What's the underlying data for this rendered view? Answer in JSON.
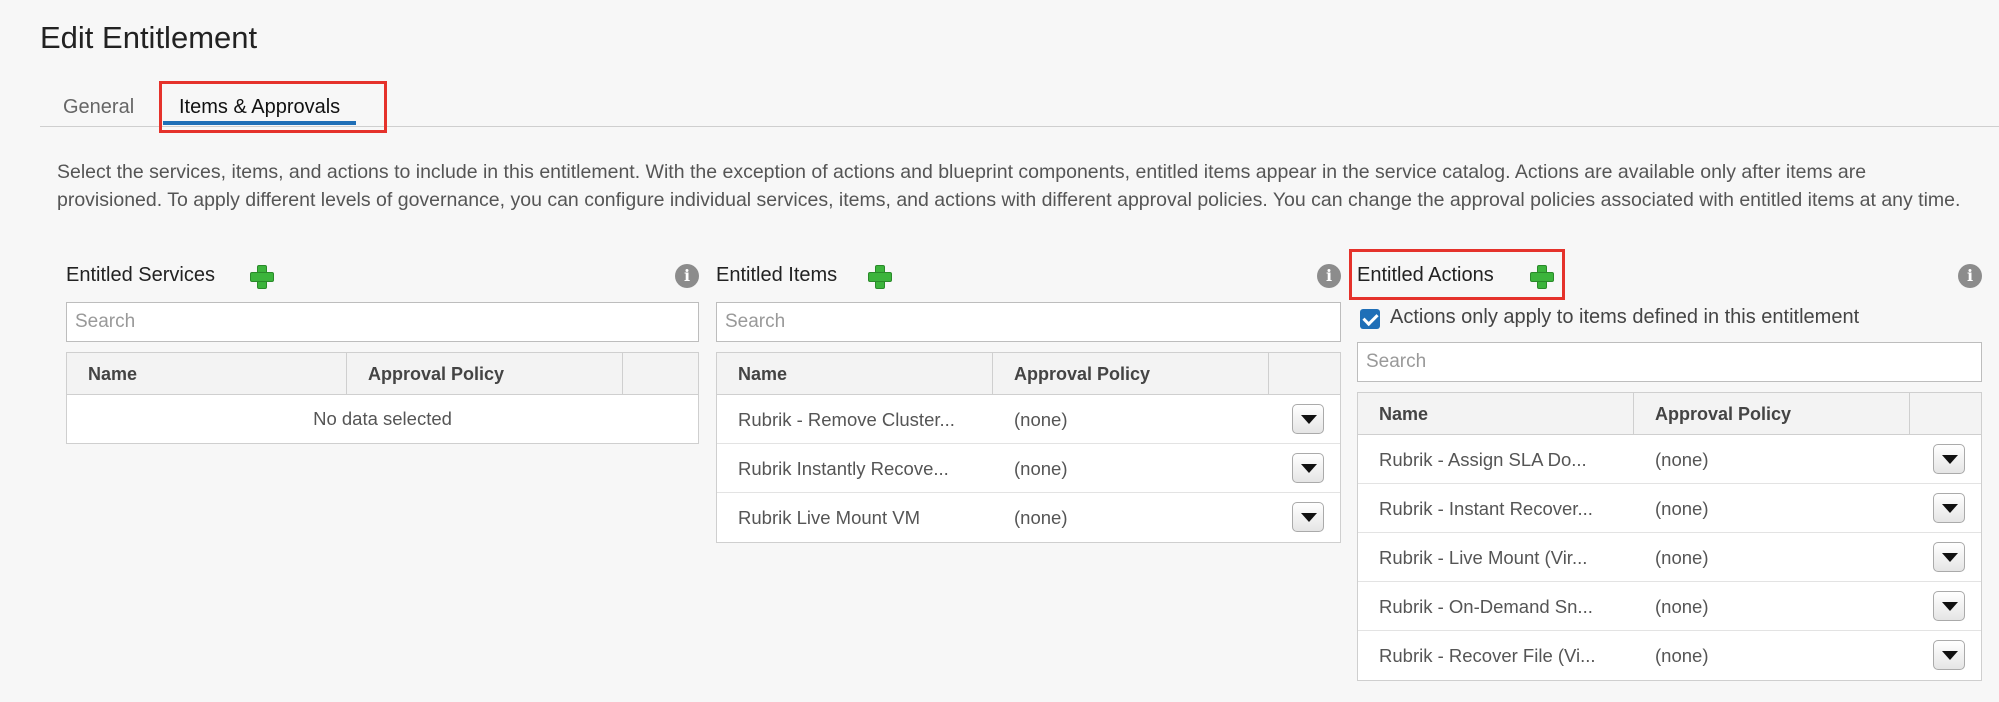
{
  "page": {
    "title": "Edit Entitlement"
  },
  "tabs": [
    {
      "label": "General",
      "active": false
    },
    {
      "label": "Items & Approvals",
      "active": true
    }
  ],
  "description": "Select the services, items, and actions to include in this entitlement. With the exception of actions and blueprint components, entitled items appear in the service catalog. Actions are available only after items are provisioned. To apply different levels of governance, you can configure individual services, items, and actions with different approval policies. You can change the approval policies associated with entitled items at any time.",
  "columns": {
    "name": "Name",
    "approval_policy": "Approval Policy"
  },
  "services": {
    "title": "Entitled Services",
    "search_placeholder": "Search",
    "empty_text": "No data selected"
  },
  "items": {
    "title": "Entitled Items",
    "search_placeholder": "Search",
    "rows": [
      {
        "name": "Rubrik - Remove Cluster...",
        "policy": "(none)"
      },
      {
        "name": "Rubrik Instantly Recove...",
        "policy": "(none)"
      },
      {
        "name": "Rubrik Live Mount VM",
        "policy": "(none)"
      }
    ]
  },
  "actions": {
    "title": "Entitled Actions",
    "checkbox_label": "Actions only apply to items defined in this entitlement",
    "checkbox_checked": true,
    "search_placeholder": "Search",
    "rows": [
      {
        "name": "Rubrik - Assign SLA Do...",
        "policy": "(none)"
      },
      {
        "name": "Rubrik - Instant Recover...",
        "policy": "(none)"
      },
      {
        "name": "Rubrik - Live Mount (Vir...",
        "policy": "(none)"
      },
      {
        "name": "Rubrik - On-Demand Sn...",
        "policy": "(none)"
      },
      {
        "name": "Rubrik - Recover File (Vi...",
        "policy": "(none)"
      }
    ]
  },
  "icons": {
    "add": "plus-icon",
    "info": "info-icon",
    "dropdown": "caret-down-icon"
  },
  "colors": {
    "accent": "#1f6fb7",
    "add_green": "#3cb43c",
    "highlight_red": "#e5322b"
  }
}
